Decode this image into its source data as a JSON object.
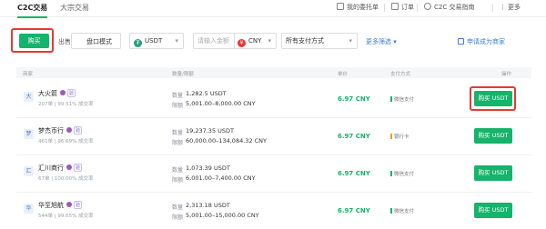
{
  "top_nav": {
    "tab_c2c": "C2C交易",
    "tab_block": "大宗交易",
    "my_ads": "我的委托单",
    "orders": "订单",
    "guide": "C2C 交易指南",
    "more": "更多"
  },
  "filter": {
    "buy": "购买",
    "sell": "出售",
    "mode": "盘口模式",
    "coin": "USDT",
    "amount_placeholder": "请输入金额",
    "fiat": "CNY",
    "payment": "所有支付方式",
    "more_filters": "更多筛选",
    "become_merchant": "申请成为商家"
  },
  "table": {
    "headers": {
      "merchant": "商家",
      "amount": "数量/限额",
      "price": "单价",
      "payment": "支付方式",
      "action": "操作"
    },
    "qty_label": "数量",
    "limit_label": "限额",
    "rows": [
      {
        "avatar": "大",
        "name": "大火箭",
        "cert": "验",
        "stats": "207单 | 99.51% 成交率",
        "qty": "1,282.5 USDT",
        "limit": "5,001.00–8,000.00 CNY",
        "price": "6.97 CNY",
        "payment": "微信支付",
        "action": "购买 USDT"
      },
      {
        "avatar": "梦",
        "name": "梦杰币行",
        "cert": "验",
        "stats": "461单 | 96.69% 成交率",
        "qty": "19,237.35 USDT",
        "limit": "60,000.00–134,084.32 CNY",
        "price": "6.97 CNY",
        "payment": "银行卡",
        "action": "购买 USDT"
      },
      {
        "avatar": "汇",
        "name": "汇川商行",
        "cert": "验",
        "stats": "67单 | 100.00% 成交率",
        "qty": "1,073.39 USDT",
        "limit": "6,001.00–7,400.00 CNY",
        "price": "6.97 CNY",
        "payment": "微信支付",
        "action": "购买 USDT"
      },
      {
        "avatar": "华",
        "name": "华至旭航",
        "cert": "验",
        "stats": "544单 | 99.65% 成交率",
        "qty": "2,313.18 USDT",
        "limit": "5,001.00–15,000.00 CNY",
        "price": "6.97 CNY",
        "payment": "微信支付",
        "action": "购买 USDT"
      }
    ]
  },
  "colors": {
    "accent": "#15b36b",
    "highlight": "#e53935",
    "link": "#3d7bd8",
    "bank": "#f0a020"
  }
}
